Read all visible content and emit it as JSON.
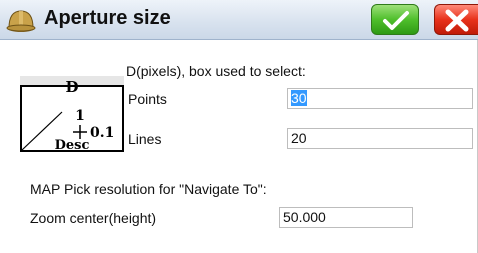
{
  "window": {
    "title": "Aperture size"
  },
  "toolbar": {
    "ok_icon": "check-icon",
    "cancel_icon": "x-icon"
  },
  "diagram": {
    "header_text": "D",
    "value_text": "1",
    "scale_text": "0.1",
    "footer_text": "Desc"
  },
  "aperture": {
    "heading": "D(pixels), box used to select:",
    "points_label": "Points",
    "points_value": "30",
    "lines_label": "Lines",
    "lines_value": "20"
  },
  "map_pick": {
    "heading": "MAP Pick resolution for \"Navigate To\":",
    "zoom_label": "Zoom center(height)",
    "zoom_value": "50.000"
  },
  "colors": {
    "titlebar": "#d9e3ef",
    "ok_green": "#4fbf2c",
    "cancel_red": "#e8321b",
    "selection": "#3399ff"
  }
}
